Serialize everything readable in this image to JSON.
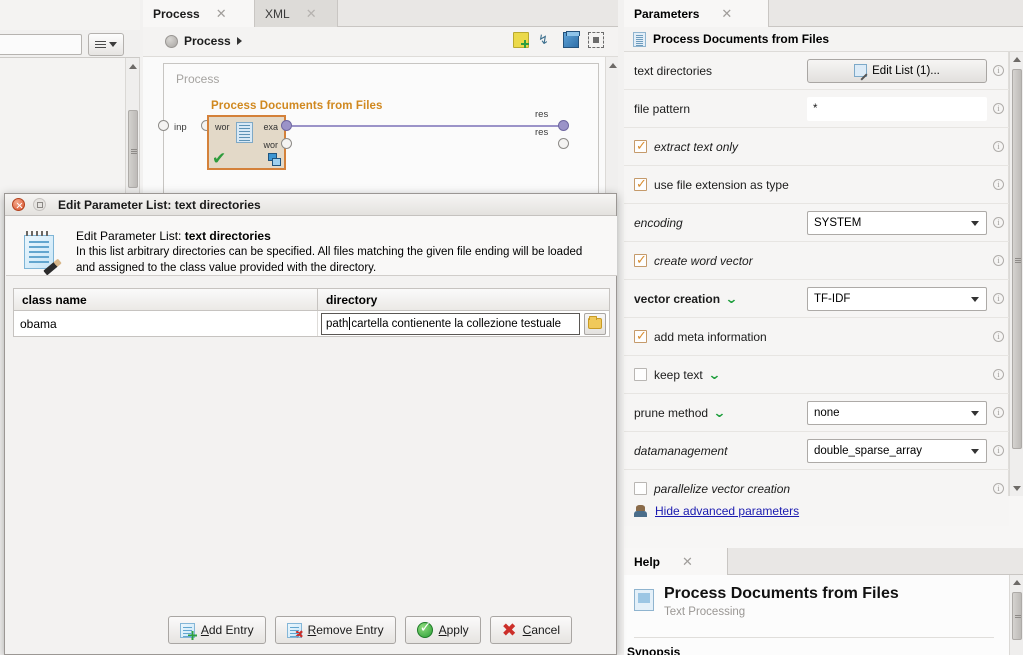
{
  "left_panel": {
    "search_placeholder": "",
    "menu_icon": "hamburger-icon"
  },
  "process_panel": {
    "tabs": [
      {
        "label": "Process",
        "active": true
      },
      {
        "label": "XML",
        "active": false
      }
    ],
    "breadcrumb": "Process",
    "toolbar_icons": [
      "new-note-icon",
      "connect-ports-icon",
      "add-subprocess-icon",
      "auto-fit-icon"
    ],
    "canvas": {
      "frame_label": "Process",
      "input_port_label": "inp",
      "result_port_labels": [
        "res",
        "res"
      ],
      "operator": {
        "title": "Process Documents from Files",
        "input_port": "wor",
        "output_ports": [
          "exa",
          "wor"
        ],
        "status": "ok-check-icon"
      }
    }
  },
  "parameters_panel": {
    "tab_label": "Parameters",
    "operator_title": "Process Documents from Files",
    "rows": [
      {
        "label": "text directories",
        "style": "plain",
        "control": "button",
        "value": "Edit List (1)...",
        "expert": false
      },
      {
        "label": "file pattern",
        "style": "plain",
        "control": "text",
        "value": "*",
        "expert": false
      },
      {
        "label": "extract text only",
        "style": "italic",
        "control": "checkbox",
        "checked": true,
        "expert": false
      },
      {
        "label": "use file extension as type",
        "style": "plain",
        "control": "checkbox",
        "checked": true,
        "expert": false
      },
      {
        "label": "encoding",
        "style": "italic",
        "control": "select",
        "value": "SYSTEM",
        "expert": false
      },
      {
        "label": "create word vector",
        "style": "italic",
        "control": "checkbox",
        "checked": true,
        "expert": false
      },
      {
        "label": "vector creation",
        "style": "bold",
        "control": "select",
        "value": "TF-IDF",
        "expert": true
      },
      {
        "label": "add meta information",
        "style": "plain",
        "control": "checkbox",
        "checked": true,
        "expert": false
      },
      {
        "label": "keep text",
        "style": "plain",
        "control": "checkbox",
        "checked": false,
        "expert": true
      },
      {
        "label": "prune method",
        "style": "plain",
        "control": "select",
        "value": "none",
        "expert": true
      },
      {
        "label": "datamanagement",
        "style": "italic",
        "control": "select",
        "value": "double_sparse_array",
        "expert": false
      },
      {
        "label": "parallelize vector creation",
        "style": "italic",
        "control": "checkbox",
        "checked": false,
        "expert": false
      }
    ],
    "advanced_link": "Hide advanced parameters",
    "info_glyph": "i"
  },
  "help_panel": {
    "tab_label": "Help",
    "title": "Process Documents from Files",
    "subtitle": "Text Processing",
    "section": "Synopsis"
  },
  "dialog": {
    "title": "Edit Parameter List: text directories",
    "info_prefix": "Edit Parameter List: ",
    "info_bold": "text directories",
    "info_description": "In this list arbitrary directories can be specified. All files matching the given file ending will be loaded and assigned to the class value provided with the directory.",
    "columns": [
      "class name",
      "directory"
    ],
    "row": {
      "class_name": "obama",
      "directory_before_caret": "path",
      "directory_after_caret": "cartella contienente la collezione testuale"
    },
    "buttons": [
      {
        "label_pre": "",
        "mnemonic": "A",
        "label_post": "dd Entry",
        "name": "add-entry-button"
      },
      {
        "label_pre": "",
        "mnemonic": "R",
        "label_post": "emove Entry",
        "name": "remove-entry-button"
      },
      {
        "label_pre": "",
        "mnemonic": "A",
        "label_post": "pply",
        "name": "apply-button"
      },
      {
        "label_pre": "",
        "mnemonic": "C",
        "label_post": "ancel",
        "name": "cancel-button"
      }
    ]
  },
  "colors": {
    "operator_border": "#d4813a",
    "operator_title": "#d0881f",
    "expert_chevron": "#1e9e3c",
    "checkbox_border": "#c59a6a",
    "link": "#1a1ab0",
    "wire": "#9b93c8"
  }
}
